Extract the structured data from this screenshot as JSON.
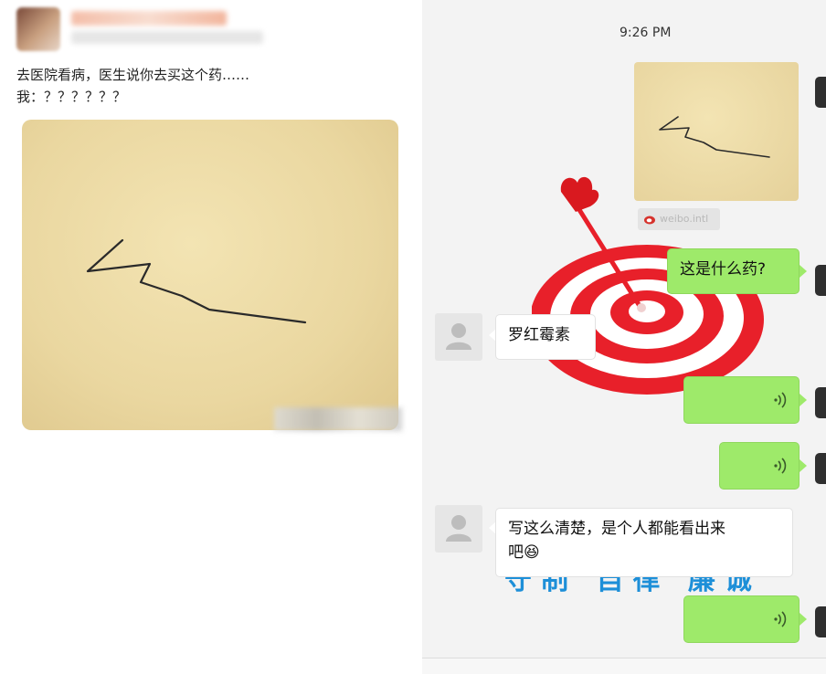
{
  "post": {
    "line1": "去医院看病，医生说你去买这个药……",
    "line2": "我：？？？？？？"
  },
  "chat": {
    "time": "9:26 PM",
    "watermark_site": "weibo.intl",
    "question": "这是什么药?",
    "reply1": "罗红霉素",
    "reply2_line1": "写这么清楚，是个人都能看出来",
    "reply2_line2": "吧😆",
    "bg_watermark": "守制 自律 廉诚"
  },
  "colors": {
    "sent_bubble": "#9eea6a",
    "received_bubble": "#ffffff",
    "chat_bg": "#f3f3f3",
    "target_red": "#e8202a"
  },
  "icons": [
    "voice-message-icon",
    "default-avatar-icon",
    "weibo-logo-icon",
    "dart-target-image"
  ]
}
